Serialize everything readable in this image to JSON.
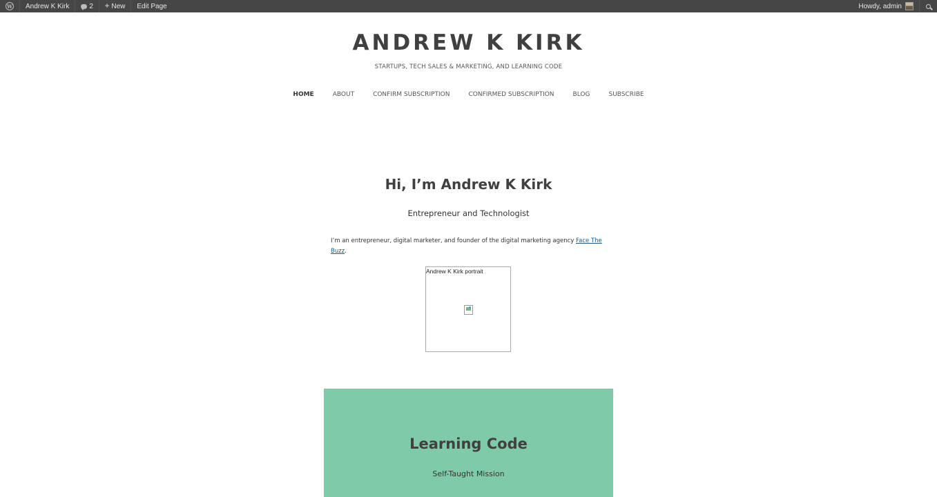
{
  "admin_bar": {
    "site_name": "Andrew K Kirk",
    "comments_count": "2",
    "new_label": "New",
    "edit_label": "Edit Page",
    "howdy": "Howdy, admin"
  },
  "header": {
    "site_title": "ANDREW K KIRK",
    "tagline": "STARTUPS, TECH SALES & MARKETING, AND LEARNING CODE"
  },
  "nav": {
    "items": [
      {
        "label": "HOME"
      },
      {
        "label": "ABOUT"
      },
      {
        "label": "CONFIRM SUBSCRIPTION"
      },
      {
        "label": "CONFIRMED SUBSCRIPTION"
      },
      {
        "label": "BLOG"
      },
      {
        "label": "SUBSCRIBE"
      }
    ]
  },
  "intro": {
    "heading": "Hi, I’m Andrew K Kirk",
    "subheading": "Entrepreneur and Technologist",
    "text_before": "I’m an entrepreneur, digital marketer, and founder of the digital marketing agency ",
    "link": "Face The Buzz",
    "text_after": ".",
    "portrait_alt": "Andrew K Kirk portrait"
  },
  "learning": {
    "title": "Learning Code",
    "subtitle": "Self-Taught Mission",
    "bg_color": "#7fcaa9"
  }
}
